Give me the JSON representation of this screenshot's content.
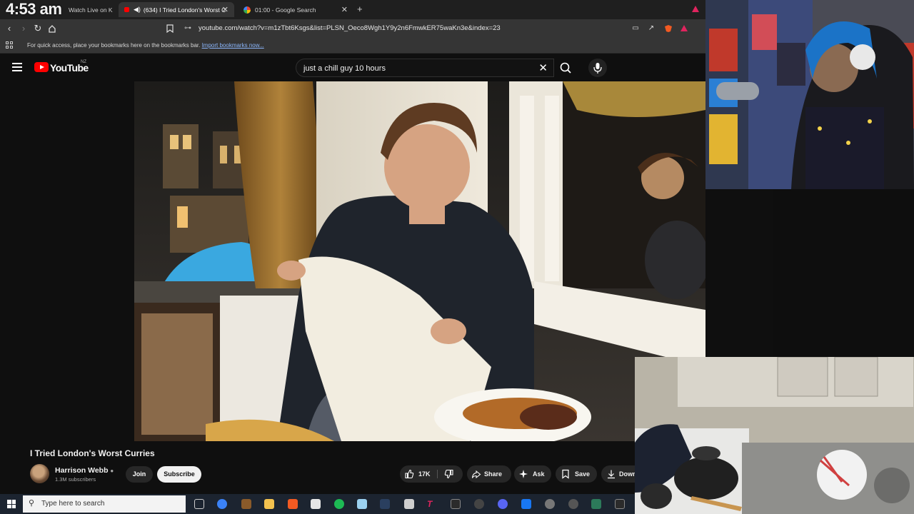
{
  "overlay": {
    "clock": "4:53 am"
  },
  "browser": {
    "tabs": [
      {
        "label": "Watch Live on K",
        "active": false
      },
      {
        "label": "(634) I Tried London's Worst C",
        "active": true
      },
      {
        "label": "01:00 - Google Search",
        "active": false
      }
    ],
    "new_tab": "+",
    "url": "youtube.com/watch?v=m1zTbt6Ksgs&list=PLSN_Oeco8Wgh1Y9y2n6FmwkER75waKn3e&index=23",
    "bookmarks_message": "For quick access, place your bookmarks here on the bookmarks bar.",
    "bookmarks_link": "Import bookmarks now..."
  },
  "youtube": {
    "logo": "YouTube",
    "region": "NZ",
    "search_value": "just a chill guy 10 hours",
    "video": {
      "title": "I Tried London's Worst Curries",
      "channel": "Harrison Webb",
      "subscribers": "1.3M subscribers",
      "join": "Join",
      "subscribe": "Subscribe",
      "likes": "17K",
      "share": "Share",
      "ask": "Ask",
      "save": "Save",
      "download": "Down"
    }
  },
  "taskbar": {
    "search_placeholder": "Type here to search"
  },
  "colors": {
    "yt_red": "#ff0000",
    "link_blue": "#8ab4f8",
    "background": "#0f0f0f"
  }
}
